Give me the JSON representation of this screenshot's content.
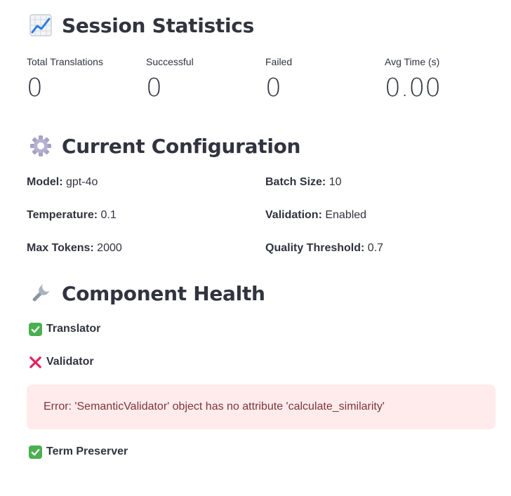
{
  "session": {
    "title": "Session Statistics",
    "icon": "chart-increasing-icon",
    "metrics": [
      {
        "label": "Total Translations",
        "value": "0"
      },
      {
        "label": "Successful",
        "value": "0"
      },
      {
        "label": "Failed",
        "value": "0"
      },
      {
        "label": "Avg Time (s)",
        "value": "0.00"
      }
    ]
  },
  "config": {
    "title": "Current Configuration",
    "icon": "gear-icon",
    "rows": [
      [
        {
          "key": "Model:",
          "value": " gpt-4o"
        },
        {
          "key": "Batch Size:",
          "value": " 10"
        }
      ],
      [
        {
          "key": "Temperature:",
          "value": " 0.1"
        },
        {
          "key": "Validation:",
          "value": " Enabled"
        }
      ],
      [
        {
          "key": "Max Tokens:",
          "value": " 2000"
        },
        {
          "key": "Quality Threshold:",
          "value": " 0.7"
        }
      ]
    ]
  },
  "health": {
    "title": "Component Health",
    "icon": "wrench-icon",
    "items": [
      {
        "label": "Translator",
        "status": "ok"
      },
      {
        "label": "Validator",
        "status": "error"
      },
      {
        "label": "Term Preserver",
        "status": "ok"
      }
    ],
    "error_message": "Error: 'SemanticValidator' object has no attribute 'calculate_similarity'"
  },
  "colors": {
    "text": "#31333f",
    "check_green": "#4caf50",
    "cross_red": "#e0245e",
    "error_bg": "#ffebeb",
    "error_text": "#7d353b"
  }
}
